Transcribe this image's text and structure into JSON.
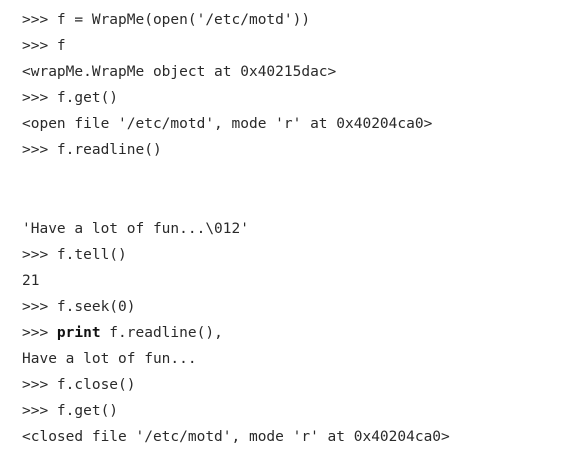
{
  "lines": [
    {
      "prompt": ">>> ",
      "text": "f = WrapMe(open('/etc/motd'))"
    },
    {
      "prompt": ">>> ",
      "text": "f"
    },
    {
      "prompt": "",
      "text": "<wrapMe.WrapMe object at 0x40215dac>"
    },
    {
      "prompt": ">>> ",
      "text": "f.get()"
    },
    {
      "prompt": "",
      "text": "<open file '/etc/motd', mode 'r' at 0x40204ca0>"
    },
    {
      "prompt": ">>> ",
      "text": "f.readline()"
    },
    {
      "prompt": "",
      "text": "'Have a lot of fun...\\012'"
    },
    {
      "prompt": ">>> ",
      "text": "f.tell()"
    },
    {
      "prompt": "",
      "text": "21"
    },
    {
      "prompt": ">>> ",
      "text": "f.seek(0)"
    },
    {
      "prompt": ">>> ",
      "keyword": "print",
      "text": " f.readline(),"
    },
    {
      "prompt": "",
      "text": "Have a lot of fun..."
    },
    {
      "prompt": ">>> ",
      "text": "f.close()"
    },
    {
      "prompt": ">>> ",
      "text": "f.get()"
    },
    {
      "prompt": "",
      "text": "<closed file '/etc/motd', mode 'r' at 0x40204ca0>"
    }
  ]
}
